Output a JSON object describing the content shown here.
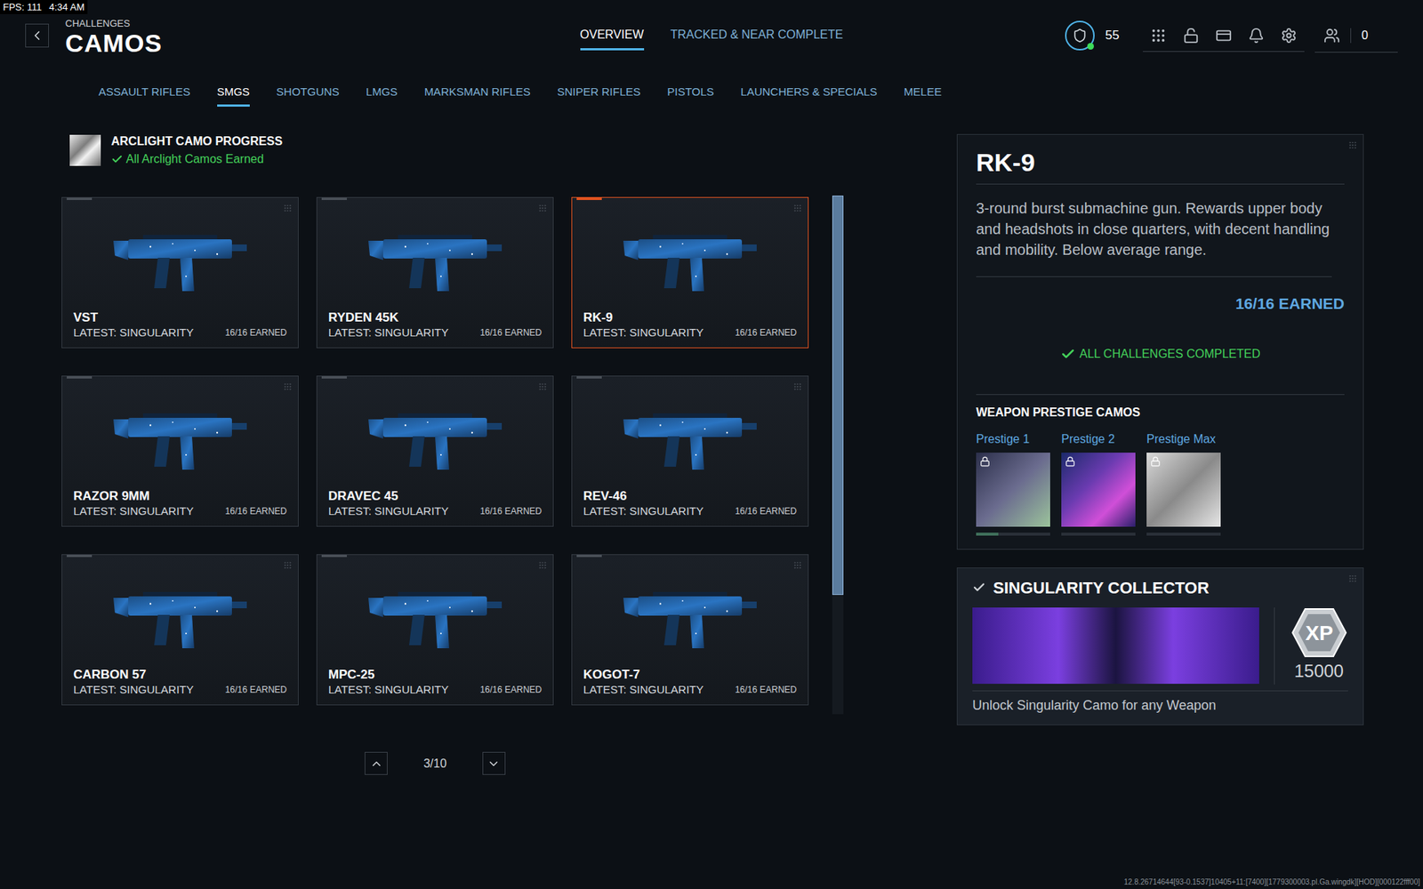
{
  "overlay": {
    "fps": "FPS: 111",
    "time": "4:34 AM"
  },
  "header": {
    "breadcrumb": "CHALLENGES",
    "title": "CAMOS"
  },
  "tabs": [
    {
      "label": "OVERVIEW",
      "selected": true
    },
    {
      "label": "TRACKED & NEAR COMPLETE",
      "selected": false
    }
  ],
  "player": {
    "level": "55",
    "currency": "0"
  },
  "categories": [
    {
      "label": "ASSAULT RIFLES",
      "selected": false
    },
    {
      "label": "SMGS",
      "selected": true
    },
    {
      "label": "SHOTGUNS",
      "selected": false
    },
    {
      "label": "LMGS",
      "selected": false
    },
    {
      "label": "MARKSMAN RIFLES",
      "selected": false
    },
    {
      "label": "SNIPER RIFLES",
      "selected": false
    },
    {
      "label": "PISTOLS",
      "selected": false
    },
    {
      "label": "LAUNCHERS & SPECIALS",
      "selected": false
    },
    {
      "label": "MELEE",
      "selected": false
    }
  ],
  "arclight": {
    "title": "ARCLIGHT CAMO PROGRESS",
    "status": "All Arclight Camos Earned",
    "complete": true
  },
  "weapons": [
    {
      "name": "VST",
      "latest": "LATEST: SINGULARITY",
      "earned": "16/16 EARNED",
      "selected": false
    },
    {
      "name": "RYDEN 45K",
      "latest": "LATEST: SINGULARITY",
      "earned": "16/16 EARNED",
      "selected": false
    },
    {
      "name": "RK-9",
      "latest": "LATEST: SINGULARITY",
      "earned": "16/16 EARNED",
      "selected": true
    },
    {
      "name": "RAZOR 9MM",
      "latest": "LATEST: SINGULARITY",
      "earned": "16/16 EARNED",
      "selected": false
    },
    {
      "name": "DRAVEC 45",
      "latest": "LATEST: SINGULARITY",
      "earned": "16/16 EARNED",
      "selected": false
    },
    {
      "name": "REV-46",
      "latest": "LATEST: SINGULARITY",
      "earned": "16/16 EARNED",
      "selected": false
    },
    {
      "name": "CARBON 57",
      "latest": "LATEST: SINGULARITY",
      "earned": "16/16 EARNED",
      "selected": false
    },
    {
      "name": "MPC-25",
      "latest": "LATEST: SINGULARITY",
      "earned": "16/16 EARNED",
      "selected": false
    },
    {
      "name": "KOGOT-7",
      "latest": "LATEST: SINGULARITY",
      "earned": "16/16 EARNED",
      "selected": false
    }
  ],
  "scrollbar": {
    "level": 0.77
  },
  "pagination": {
    "page": "3/10"
  },
  "detail": {
    "name": "RK-9",
    "description": "3-round burst submachine gun. Rewards upper body and headshots in close quarters, with decent handling and mobility. Below average range.",
    "earned": "16/16 EARNED",
    "status": "ALL CHALLENGES COMPLETED",
    "complete": true,
    "prestige_title": "WEAPON PRESTIGE CAMOS",
    "prestige": [
      {
        "label": "Prestige 1",
        "locked": true,
        "level": 0.3
      },
      {
        "label": "Prestige 2",
        "locked": true,
        "level": 0
      },
      {
        "label": "Prestige Max",
        "locked": true,
        "level": 0
      }
    ]
  },
  "reward": {
    "title": "SINGULARITY COLLECTOR",
    "checked": true,
    "badge": "XP",
    "amount": "15000",
    "description": "Unlock Singularity Camo for any Weapon"
  },
  "build": "12.8.26714644[93-0.1537]10405+11:[7400][1779300003.pl.Ga.wingdk][HOD][000122fff00]"
}
